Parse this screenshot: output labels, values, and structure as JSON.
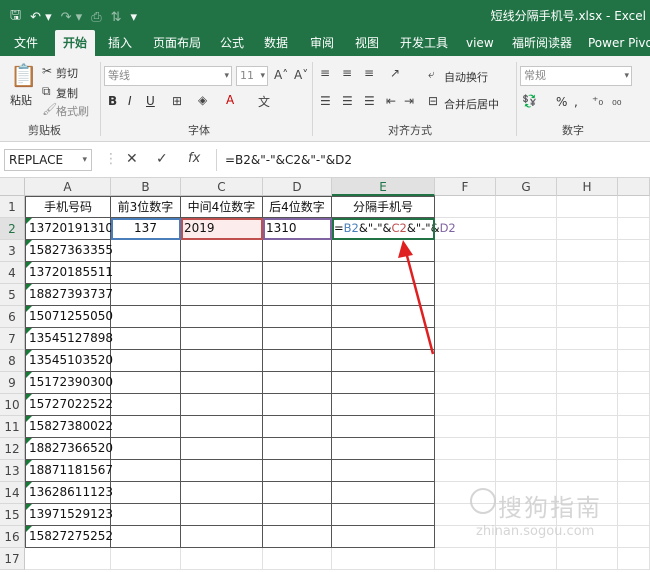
{
  "titlebar": {
    "qat": [
      "save-icon",
      "undo-icon",
      "redo-icon",
      "print-preview-icon",
      "sort-icon",
      "customize-icon"
    ],
    "doc_title": "短线分隔手机号.xlsx  -  Excel"
  },
  "tabs": [
    "文件",
    "开始",
    "插入",
    "页面布局",
    "公式",
    "数据",
    "审阅",
    "视图",
    "开发工具",
    "view",
    "福昕阅读器",
    "Power Pivot"
  ],
  "ribbon": {
    "clipboard": {
      "paste": "粘贴",
      "cut": "剪切",
      "copy": "复制",
      "format_painter": "格式刷",
      "group": "剪贴板"
    },
    "font": {
      "name": "等线",
      "size": "11",
      "group": "字体",
      "bold": "B",
      "italic": "I",
      "underline": "U"
    },
    "alignment": {
      "wrap": "自动换行",
      "merge": "合并后居中",
      "group": "对齐方式"
    },
    "number": {
      "format": "常规",
      "group": "数字",
      "percent": "%",
      "comma": ","
    }
  },
  "formula_bar": {
    "name_box": "REPLACE",
    "cancel": "✕",
    "confirm": "✓",
    "fx": "fx",
    "formula": "=B2&\"-\"&C2&\"-\"&D2"
  },
  "grid": {
    "columns": [
      "A",
      "B",
      "C",
      "D",
      "E",
      "F",
      "G",
      "H"
    ],
    "rows": [
      "1",
      "2",
      "3",
      "4",
      "5",
      "6",
      "7",
      "8",
      "9",
      "10",
      "11",
      "12",
      "13",
      "14",
      "15",
      "16",
      "17"
    ],
    "headers": [
      "手机号码",
      "前3位数字",
      "中间4位数字",
      "后4位数字",
      "分隔手机号"
    ],
    "row2": {
      "b": "137",
      "c": "2019",
      "d": "1310"
    },
    "editing": {
      "p1": "=",
      "b": "B2",
      "p2": "&\"-\"&",
      "c": "C2",
      "p3": "&\"-\"&",
      "d": "D2"
    },
    "phones": [
      "13720191310",
      "15827363355",
      "13720185511",
      "18827393737",
      "15071255050",
      "13545127898",
      "13545103520",
      "15172390300",
      "15727022522",
      "15827380022",
      "18827366520",
      "18871181567",
      "13628611123",
      "13971529123",
      "15827275252"
    ]
  },
  "watermark": {
    "cn": "搜狗指南",
    "url": "zhinan.sogou.com"
  },
  "colors": {
    "excel_green": "#217346",
    "ref_blue": "#4a7ebb",
    "ref_red": "#c0504d",
    "ref_purple": "#8064a2",
    "arrow": "#e02020"
  }
}
